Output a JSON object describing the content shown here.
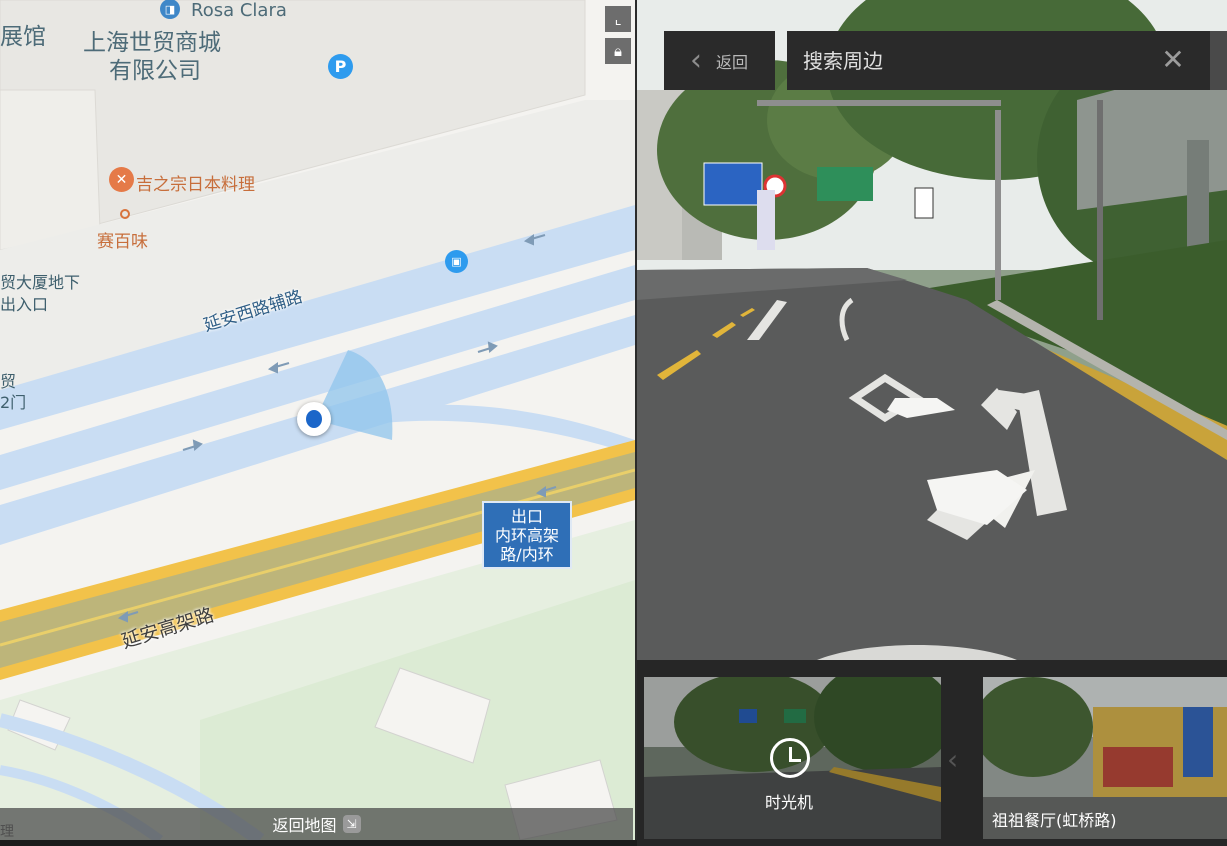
{
  "map": {
    "labels": {
      "exhibition": "展馆",
      "wtc_line1": "上海世贸商城",
      "wtc_line2": "有限公司",
      "brand": "Rosa Clara",
      "restaurant": "吉之宗日本料理",
      "saibaiwei": "赛百味",
      "basement_line1": "贸大厦地下",
      "basement_line2": "出入口",
      "gate_line1": "贸",
      "gate_line2": "2门",
      "side_road": "延安西路辅路",
      "elevated": "延安高架路",
      "exit_line1": "出口",
      "exit_line2": "内环高架",
      "exit_line3": "路/内环",
      "bottom_left": "理"
    },
    "icons": {
      "parking": "P",
      "bus": "bus-icon",
      "food": "fork-knife-icon",
      "brand": "shopping-icon"
    },
    "back_to_map": "返回地图"
  },
  "street": {
    "back_label": "返回",
    "search_placeholder": "搜索周边",
    "clear_icon": "close-icon"
  },
  "thumbnails": [
    {
      "caption": "时光机",
      "icon": "clock-icon"
    },
    {
      "caption": "祖祖餐厅(虹桥路)"
    }
  ],
  "colors": {
    "map_bg": "#f4f3f0",
    "road_blue": "#cfe1f5",
    "elevated_yellow": "#f7c948",
    "exit_sign": "#2f6fb7",
    "panel_dark": "#2a2a2a"
  }
}
